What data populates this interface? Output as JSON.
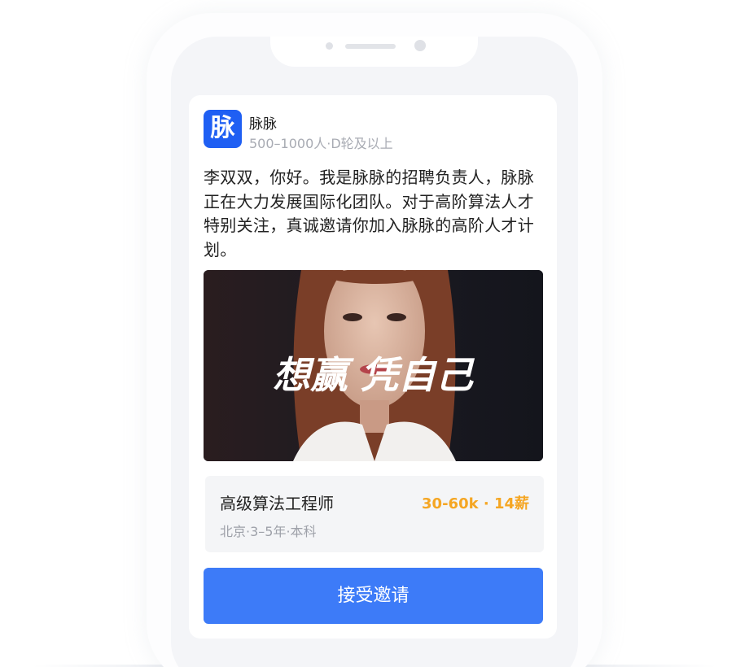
{
  "company": {
    "logo_char": "脉",
    "name": "脉脉",
    "meta": "500–1000人·D轮及以上"
  },
  "message": "李双双，你好。我是脉脉的招聘负责人，脉脉正在大力发展国际化团队。对于高阶算法人才特别关注，真诚邀请你加入脉脉的高阶人才计划。",
  "video": {
    "slogan": "想赢 凭自己"
  },
  "job": {
    "title": "高级算法工程师",
    "salary": "30-60k · 14薪",
    "meta": "北京·3–5年·本科"
  },
  "action": {
    "accept_label": "接受邀请"
  },
  "colors": {
    "brand": "#1f5ff3",
    "button": "#3d7bf8",
    "salary": "#f5a623"
  }
}
